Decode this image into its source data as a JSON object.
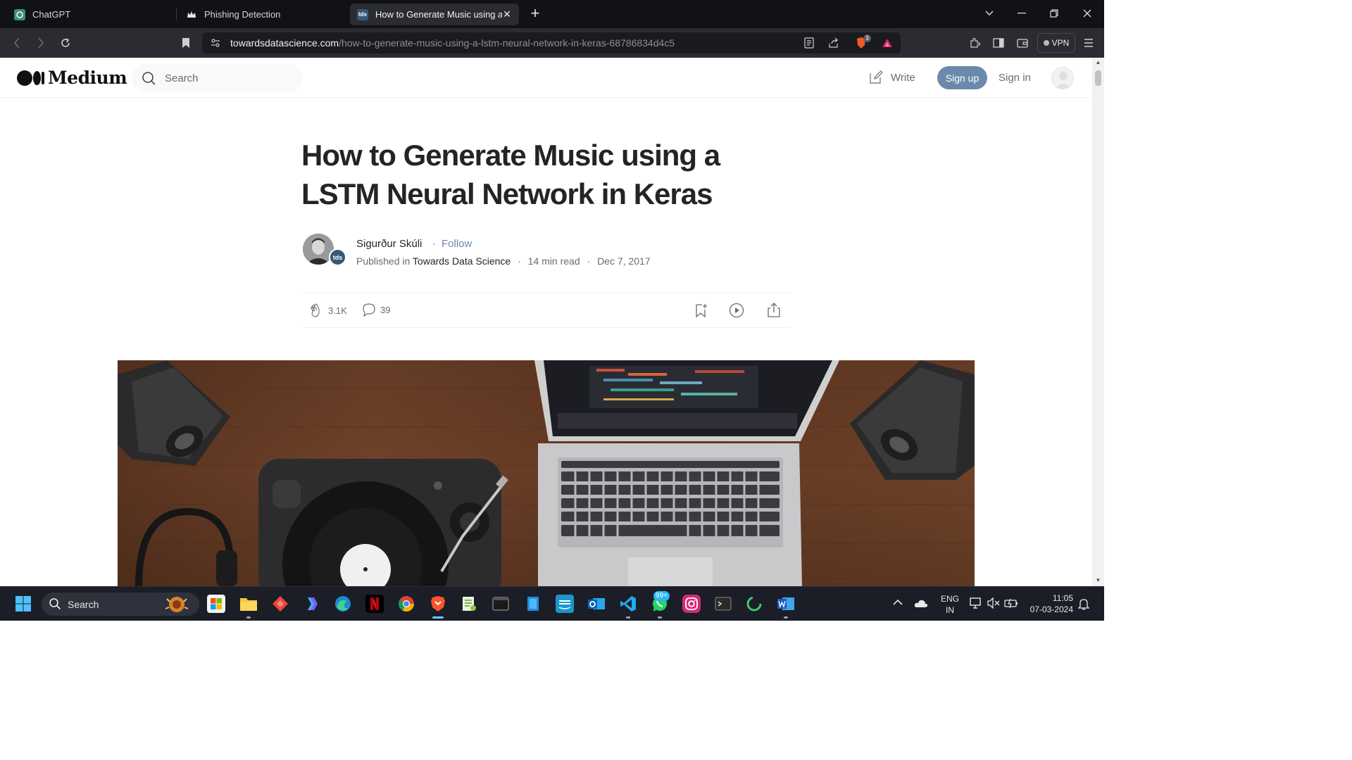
{
  "browser": {
    "tabs": [
      {
        "title": "ChatGPT",
        "favicon": "openai-icon",
        "active": false
      },
      {
        "title": "Phishing Detection",
        "favicon": "crown-icon",
        "active": false
      },
      {
        "title": "How to Generate Music using a",
        "favicon": "tds",
        "active": true
      }
    ],
    "url_domain": "towardsdatascience.com",
    "url_path": "/how-to-generate-music-using-a-lstm-neural-network-in-keras-68786834d4c5",
    "shields_count": "3",
    "vpn_label": "VPN"
  },
  "medium": {
    "logo_text": "Medium",
    "search_placeholder": "Search",
    "write_label": "Write",
    "signup_label": "Sign up",
    "signin_label": "Sign in"
  },
  "article": {
    "title_line1": "How to Generate Music using a",
    "title_line2": "LSTM Neural Network in Keras",
    "author_name": "Sigurður Skúli",
    "separator": "·",
    "follow_label": "Follow",
    "published_in_label": "Published in",
    "publication": "Towards Data Science",
    "read_time": "14 min read",
    "date": "Dec 7, 2017",
    "publication_badge": "tds",
    "claps": "3.1K",
    "responses": "39"
  },
  "taskbar": {
    "search_label": "Search",
    "whatsapp_badge": "99+",
    "lang_line1": "ENG",
    "lang_line2": "IN",
    "time": "11:05",
    "date": "07-03-2024"
  },
  "colors": {
    "accent_blue": "#6b8aab",
    "text_dark": "#242424",
    "text_muted": "#6b6b6b",
    "tds_badge": "#355876"
  }
}
